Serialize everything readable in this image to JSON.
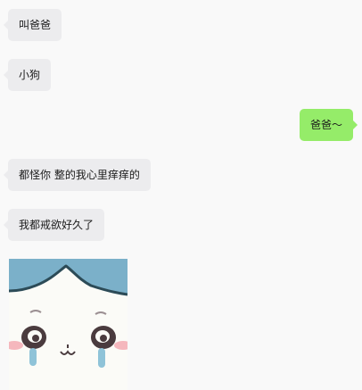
{
  "messages": [
    {
      "side": "left",
      "text": "叫爸爸"
    },
    {
      "side": "left",
      "text": "小狗"
    },
    {
      "side": "right",
      "text": "爸爸～"
    },
    {
      "side": "left",
      "text": "都怪你 整的我心里痒痒的"
    },
    {
      "side": "left",
      "text": "我都戒欲好久了"
    }
  ],
  "sticker": {
    "description_icon": "crying-cat-sticker",
    "colors": {
      "sky": "#7bb0c9",
      "face": "#fbfbf7",
      "outline": "#2c4b57",
      "eye": "#4a3b3e",
      "blush": "#f5b7bd",
      "tear": "#8fc3d8"
    }
  }
}
